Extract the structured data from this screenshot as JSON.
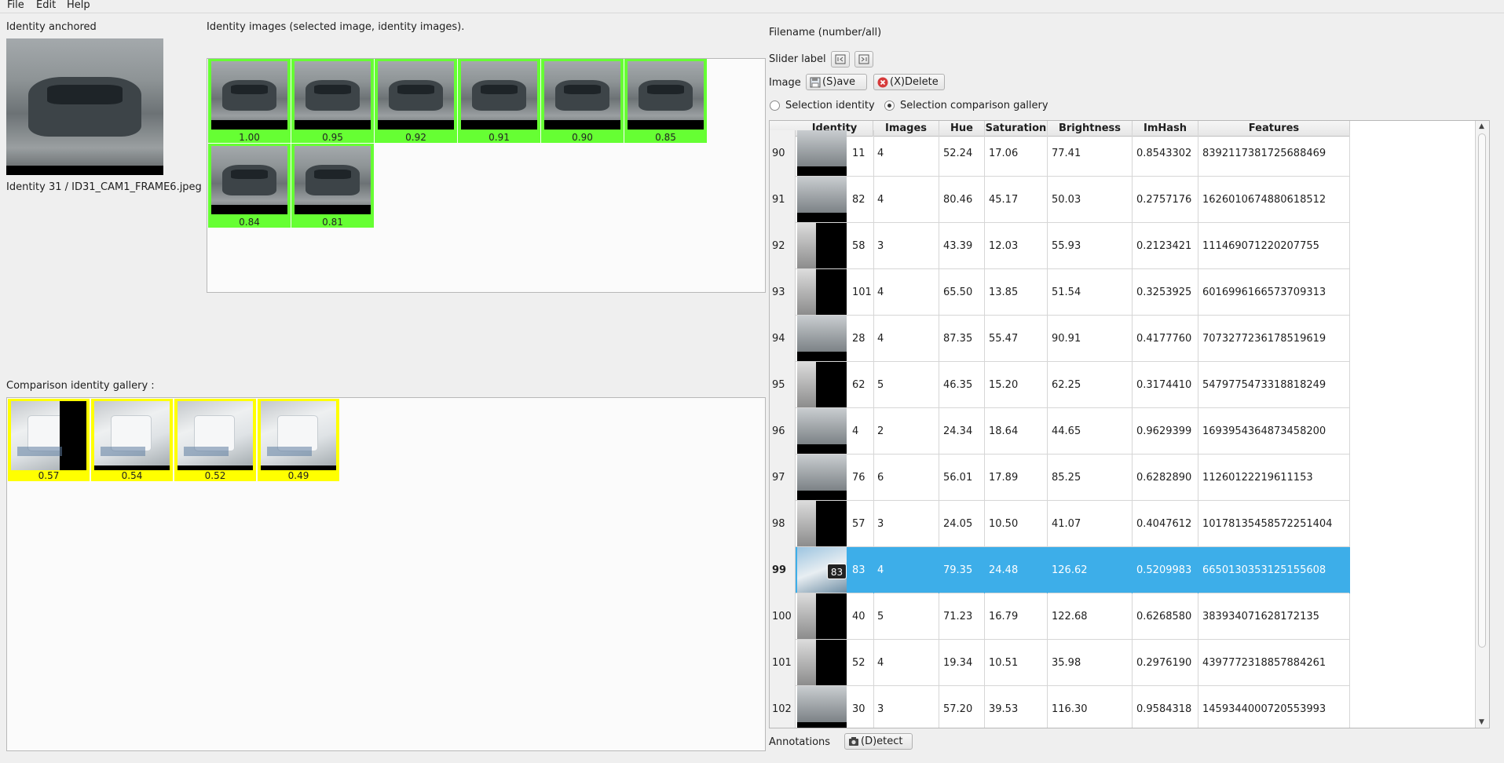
{
  "menu": {
    "file": "File",
    "edit": "Edit",
    "help": "Help"
  },
  "anchored": {
    "title": "Identity anchored",
    "caption": "Identity 31 / ID31_CAM1_FRAME6.jpeg"
  },
  "identity_images": {
    "title": "Identity images (selected image, identity images).",
    "scores": [
      "1.00",
      "0.95",
      "0.92",
      "0.91",
      "0.90",
      "0.85",
      "0.84",
      "0.81"
    ],
    "color": "#66ff33"
  },
  "comparison": {
    "title": "Comparison identity gallery :",
    "scores": [
      "0.57",
      "0.54",
      "0.52",
      "0.49"
    ],
    "color": "#ffff00"
  },
  "right": {
    "filename_label": "Filename (number/all)",
    "slider_label": "Slider label",
    "image_label": "Image",
    "save_button": "(S)ave",
    "delete_button": "(X)Delete",
    "radio_identity": "Selection identity",
    "radio_gallery": "Selection comparison gallery",
    "annotations_label": "Annotations",
    "detect_button": "(D)etect"
  },
  "table": {
    "headers": [
      "Identity",
      "Images",
      "Hue",
      "Saturation",
      "Brightness",
      "ImHash",
      "Features"
    ],
    "selected_badge": "83",
    "rows": [
      {
        "num": "90",
        "id": "11",
        "images": "4",
        "hue": "52.24",
        "sat": "17.06",
        "bri": "77.41",
        "imhash": "0.8543302",
        "features": "8392117381725688469"
      },
      {
        "num": "91",
        "id": "82",
        "images": "4",
        "hue": "80.46",
        "sat": "45.17",
        "bri": "50.03",
        "imhash": "0.2757176",
        "features": "1626010674880618512"
      },
      {
        "num": "92",
        "id": "58",
        "images": "3",
        "hue": "43.39",
        "sat": "12.03",
        "bri": "55.93",
        "imhash": "0.2123421",
        "features": "111469071220207755"
      },
      {
        "num": "93",
        "id": "101",
        "images": "4",
        "hue": "65.50",
        "sat": "13.85",
        "bri": "51.54",
        "imhash": "0.3253925",
        "features": "6016996166573709313"
      },
      {
        "num": "94",
        "id": "28",
        "images": "4",
        "hue": "87.35",
        "sat": "55.47",
        "bri": "90.91",
        "imhash": "0.4177760",
        "features": "7073277236178519619"
      },
      {
        "num": "95",
        "id": "62",
        "images": "5",
        "hue": "46.35",
        "sat": "15.20",
        "bri": "62.25",
        "imhash": "0.3174410",
        "features": "5479775473318818249"
      },
      {
        "num": "96",
        "id": "4",
        "images": "2",
        "hue": "24.34",
        "sat": "18.64",
        "bri": "44.65",
        "imhash": "0.9629399",
        "features": "1693954364873458200"
      },
      {
        "num": "97",
        "id": "76",
        "images": "6",
        "hue": "56.01",
        "sat": "17.89",
        "bri": "85.25",
        "imhash": "0.6282890",
        "features": "11260122219611153"
      },
      {
        "num": "98",
        "id": "57",
        "images": "3",
        "hue": "24.05",
        "sat": "10.50",
        "bri": "41.07",
        "imhash": "0.4047612",
        "features": "10178135458572251404"
      },
      {
        "num": "99",
        "id": "83",
        "images": "4",
        "hue": "79.35",
        "sat": "24.48",
        "bri": "126.62",
        "imhash": "0.5209983",
        "features": "6650130353125155608"
      },
      {
        "num": "100",
        "id": "40",
        "images": "5",
        "hue": "71.23",
        "sat": "16.79",
        "bri": "122.68",
        "imhash": "0.6268580",
        "features": "383934071628172135"
      },
      {
        "num": "101",
        "id": "52",
        "images": "4",
        "hue": "19.34",
        "sat": "10.51",
        "bri": "35.98",
        "imhash": "0.2976190",
        "features": "4397772318857884261"
      },
      {
        "num": "102",
        "id": "30",
        "images": "3",
        "hue": "57.20",
        "sat": "39.53",
        "bri": "116.30",
        "imhash": "0.9584318",
        "features": "1459344000720553993"
      }
    ]
  },
  "colors": {
    "selection": "#3daee9",
    "identity_tile": "#66ff33",
    "comparison_tile": "#ffff00"
  }
}
